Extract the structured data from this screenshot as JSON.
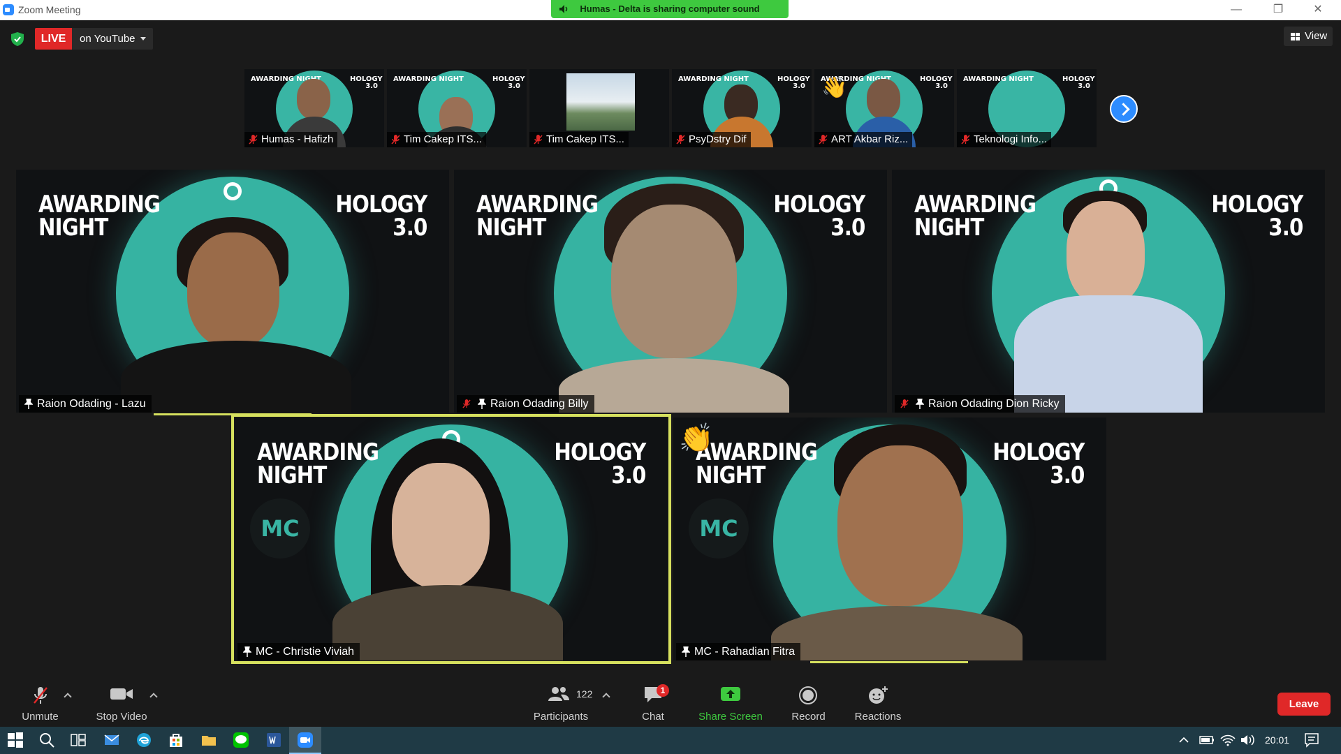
{
  "window": {
    "title": "Zoom Meeting",
    "share_banner": "Humas - Delta is sharing computer sound"
  },
  "topbar": {
    "live_label": "LIVE",
    "live_destination": "on YouTube",
    "view_label": "View"
  },
  "thumbnails": [
    {
      "name": "Humas - Hafizh",
      "muted": true,
      "title_left": "AWARDING NIGHT",
      "title_right": "HOLOGY 3.0"
    },
    {
      "name": "Tim Cakep ITS...",
      "muted": true,
      "title_left": "AWARDING NIGHT",
      "title_right": "HOLOGY 3.0"
    },
    {
      "name": "Tim Cakep ITS...",
      "muted": true
    },
    {
      "name": "PsyDstry Dif",
      "muted": true,
      "title_left": "AWARDING NIGHT",
      "title_right": "HOLOGY 3.0"
    },
    {
      "name": "ART Akbar Riz...",
      "muted": true,
      "title_left": "AWARDING NIGHT",
      "title_right": "HOLOGY 3.0"
    },
    {
      "name": "Teknologi Info...",
      "muted": true,
      "title_left": "AWARDING NIGHT",
      "title_right": "HOLOGY 3.0"
    }
  ],
  "tiles": [
    {
      "name": "Raion Odading - Lazu",
      "muted": false,
      "title_left_1": "AWARDING",
      "title_left_2": "NIGHT",
      "title_right_1": "HOLOGY",
      "title_right_2": "3.0"
    },
    {
      "name": "Raion Odading Billy",
      "muted": true,
      "title_left_1": "AWARDING",
      "title_left_2": "NIGHT",
      "title_right_1": "HOLOGY",
      "title_right_2": "3.0"
    },
    {
      "name": "Raion Odading Dion Ricky",
      "muted": true,
      "title_left_1": "AWARDING",
      "title_left_2": "NIGHT",
      "title_right_1": "HOLOGY",
      "title_right_2": "3.0"
    },
    {
      "name": "MC - Christie Viviah",
      "muted": false,
      "badge": "MC",
      "title_left_1": "AWARDING",
      "title_left_2": "NIGHT",
      "title_right_1": "HOLOGY",
      "title_right_2": "3.0"
    },
    {
      "name": "MC - Rahadian Fitra",
      "muted": false,
      "badge": "MC",
      "title_left_1": "AWARDING",
      "title_left_2": "NIGHT",
      "title_right_1": "HOLOGY",
      "title_right_2": "3.0"
    }
  ],
  "toolbar": {
    "unmute": "Unmute",
    "stop_video": "Stop Video",
    "participants": "Participants",
    "participant_count": "122",
    "chat": "Chat",
    "chat_badge": "1",
    "share_screen": "Share Screen",
    "record": "Record",
    "reactions": "Reactions",
    "leave": "Leave"
  },
  "taskbar": {
    "time": "20:01"
  },
  "colors": {
    "live_red": "#e02828",
    "share_green": "#3ec93f",
    "teal": "#36b3a2",
    "speaker_highlight": "#d6e05e",
    "zoom_blue": "#2d8cff"
  }
}
